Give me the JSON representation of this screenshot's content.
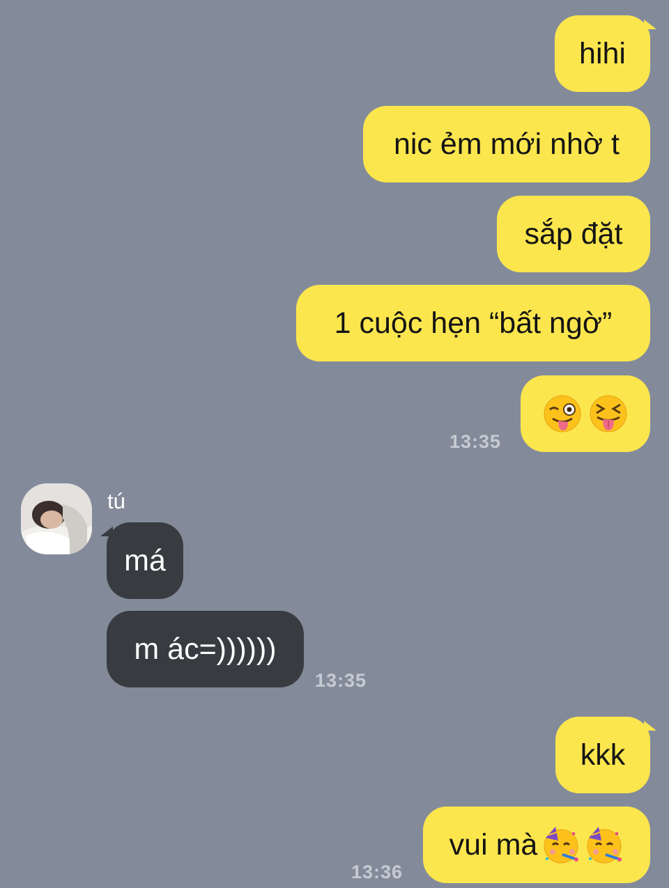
{
  "conversation": {
    "outgoing_1": {
      "messages": [
        "hihi",
        "nic ẻm mới nhờ t",
        "sắp đặt",
        "1 cuộc hẹn “bất ngờ”"
      ],
      "emoji_message": {
        "icons": [
          "winking-face-with-tongue-icon",
          "squinting-face-with-tongue-icon"
        ]
      },
      "time": "13:35"
    },
    "incoming": {
      "sender": "tú",
      "messages": [
        "má",
        "m ác=))))))"
      ],
      "time": "13:35"
    },
    "outgoing_2": {
      "messages": [
        "kkk",
        "vui mà"
      ],
      "last_icons": [
        "partying-face-icon",
        "partying-face-icon"
      ],
      "time": "13:36"
    }
  },
  "colors": {
    "background": "#838b9a",
    "outgoing_bubble": "#fce64e",
    "incoming_bubble": "#383b40",
    "timestamp": "#c6cbd3"
  }
}
